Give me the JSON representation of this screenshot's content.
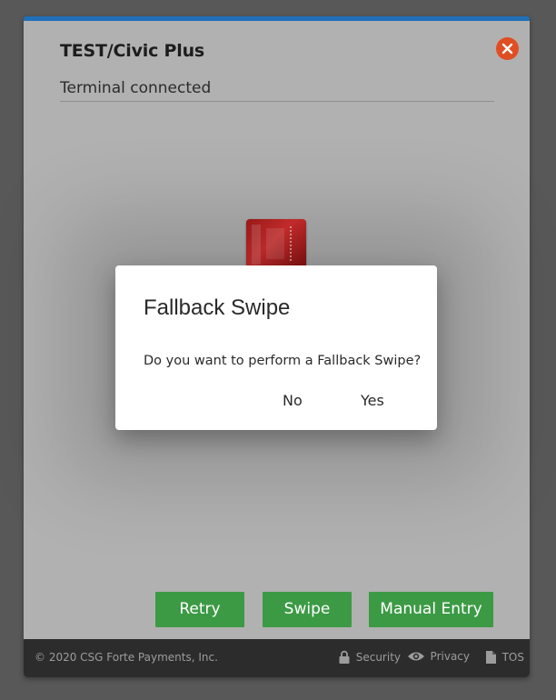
{
  "window": {
    "title": "TEST/Civic Plus",
    "status": "Terminal connected"
  },
  "card_image": {
    "description": "red card graphic"
  },
  "buttons": {
    "retry": "Retry",
    "swipe": "Swipe",
    "manual": "Manual Entry"
  },
  "footer": {
    "copyright": "© 2020 CSG Forte Payments, Inc.",
    "security": "Security",
    "privacy": "Privacy",
    "tos": "TOS"
  },
  "dialog": {
    "title": "Fallback Swipe",
    "message": "Do you want to perform a Fallback Swipe?",
    "no": "No",
    "yes": "Yes"
  },
  "colors": {
    "accent_bar": "#1f6fb8",
    "close": "#e04e23",
    "button": "#3c9a45",
    "footer_bg": "#2c2c2c"
  },
  "icons": [
    "close-icon",
    "lock-icon",
    "eye-icon",
    "document-icon"
  ]
}
